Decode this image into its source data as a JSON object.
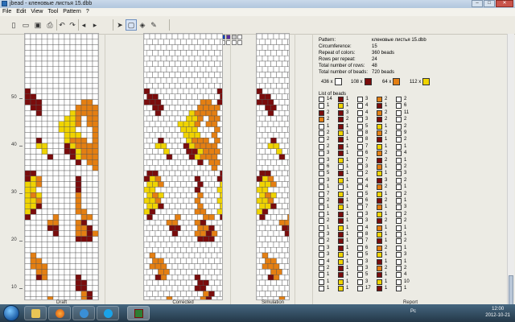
{
  "window": {
    "title": "jbead - кленовые листья 15.dbb",
    "min": "–",
    "max": "□",
    "close": "✕"
  },
  "menu": [
    "File",
    "Edit",
    "View",
    "Tool",
    "Pattern",
    "?"
  ],
  "toolbar_icons": [
    "new-icon",
    "open-icon",
    "save-icon",
    "print-icon",
    "undo-icon",
    "redo-icon",
    "arrow-left-icon",
    "arrow-right-icon",
    "pointer-icon",
    "rectangle-select-icon",
    "fill-icon",
    "pencil-icon"
  ],
  "palette_colors": [
    "#000000",
    "#6d0a0a",
    "#d4d400",
    "#e8e800",
    "#ee1c24",
    "#f08c00",
    "#3cb44b",
    "#00a0e0",
    "#0040c0",
    "#5a2da0",
    "#c8c8c8",
    "#ffffff",
    "#7a7a7a",
    "#a05a2c",
    "#c0d000",
    "#00c000",
    "#ff80c0",
    "#40e0d0",
    "#3060ff",
    "#a000a0",
    "#ffffff",
    "#ffffff",
    "#ffffff",
    "#ffffff"
  ],
  "bead_colors": {
    "white": "#ffffff",
    "dark": "#7a0c0c",
    "yellow": "#f0d400",
    "orange": "#e47f12"
  },
  "ruler": [
    "10",
    "20",
    "30",
    "40",
    "50"
  ],
  "panels": {
    "draft": "Draft",
    "corrected": "Corrected",
    "simulation": "Simulation",
    "report": "Report"
  },
  "pattern": "0000000000000,0000000000000,0000000000000,0000000000000,0000000000000,0000000000000,0000000000000,0000000000000,0000000000000,0000000000000,1000000000000,1100000000000,1110000000220,0110000002222,0010000032222,0000000332022,0000003332022,0000003330002,0000000333002,0010000322202,0033000132222,0003000113222,0000100013222,0000000001022,0000000000002,1100000000000,1320000001000,3320000001000,3300000001000,3230000002000,3320000002000,3310000002000,3100000002200,1000020000220,0000220002100,0000110002210,0000010002212,0000000001110,0000000000000,0000000000000,0200000000000,0220000000000,0222000000000,0022000000000,0012000001000,0000000001100,0000000001100,0000000000210,0000200000210,0002200002210,0002200002121,0001100001111,0000000000110,0000000000000,0000000000000,0000000000000,0200000000000,0220000000000,0222000000000,0022000000000,0012000000000,0000000000000,0000000000000,0000000000000,0000000000000,0000000000000",
  "info": {
    "pattern_label": "Pattern:",
    "pattern_value": "кленовые листья 15.dbb",
    "circ_label": "Circumference:",
    "circ_value": "15",
    "repeat_label": "Repeat of colors:",
    "repeat_value": "360 beads",
    "rows_label": "Rows per repeat:",
    "rows_value": "24",
    "total_rows_label": "Total number of rows:",
    "total_rows_value": "48",
    "total_beads_label": "Total number of beads:",
    "total_beads_value": "720 beads"
  },
  "counts": [
    {
      "count": "436 x",
      "color": "#ffffff"
    },
    {
      "count": "108 x",
      "color": "#7a0c0c"
    },
    {
      "count": "64 x",
      "color": "#e47f12"
    },
    {
      "count": "112 x",
      "color": "#f0d400"
    }
  ],
  "list_title": "List of beads",
  "bead_list": [
    [
      [
        "w",
        "14"
      ],
      [
        "w",
        "1"
      ],
      [
        "d",
        "2"
      ],
      [
        "o",
        "2"
      ],
      [
        "w",
        "1"
      ],
      [
        "w",
        "2"
      ],
      [
        "w",
        "2"
      ],
      [
        "w",
        "2"
      ],
      [
        "w",
        "3"
      ],
      [
        "w",
        "3"
      ],
      [
        "w",
        "6"
      ],
      [
        "w",
        "5"
      ],
      [
        "w",
        "3"
      ],
      [
        "w",
        "1"
      ],
      [
        "w",
        "7"
      ],
      [
        "w",
        "2"
      ],
      [
        "w",
        "1"
      ],
      [
        "w",
        "1"
      ],
      [
        "w",
        "2"
      ],
      [
        "w",
        "1"
      ],
      [
        "w",
        "3"
      ],
      [
        "w",
        "2"
      ],
      [
        "w",
        "3"
      ],
      [
        "w",
        "3"
      ],
      [
        "w",
        "4"
      ],
      [
        "w",
        "2"
      ],
      [
        "w",
        "1"
      ],
      [
        "w",
        "1"
      ],
      [
        "w",
        "1"
      ]
    ],
    [
      [
        "d",
        "1"
      ],
      [
        "y",
        "1"
      ],
      [
        "d",
        "3"
      ],
      [
        "d",
        "2"
      ],
      [
        "d",
        "1"
      ],
      [
        "y",
        "1"
      ],
      [
        "d",
        "1"
      ],
      [
        "d",
        "1"
      ],
      [
        "d",
        "1"
      ],
      [
        "y",
        "1"
      ],
      [
        "w",
        "1"
      ],
      [
        "d",
        "1"
      ],
      [
        "y",
        "1"
      ],
      [
        "w",
        "1"
      ],
      [
        "y",
        "1"
      ],
      [
        "d",
        "1"
      ],
      [
        "y",
        "1"
      ],
      [
        "d",
        "1"
      ],
      [
        "d",
        "1"
      ],
      [
        "y",
        "1"
      ],
      [
        "d",
        "1"
      ],
      [
        "d",
        "1"
      ],
      [
        "d",
        "1"
      ],
      [
        "y",
        "1"
      ],
      [
        "y",
        "1"
      ],
      [
        "d",
        "1"
      ],
      [
        "d",
        "1"
      ],
      [
        "y",
        "1"
      ],
      [
        "y",
        "1"
      ]
    ],
    [
      [
        "w",
        "3"
      ],
      [
        "w",
        "4"
      ],
      [
        "w",
        "4"
      ],
      [
        "w",
        "3"
      ],
      [
        "w",
        "5"
      ],
      [
        "w",
        "8"
      ],
      [
        "w",
        "8"
      ],
      [
        "w",
        "7"
      ],
      [
        "w",
        "6"
      ],
      [
        "w",
        "7"
      ],
      [
        "w",
        "3"
      ],
      [
        "w",
        "2"
      ],
      [
        "w",
        "4"
      ],
      [
        "w",
        "4"
      ],
      [
        "w",
        "5"
      ],
      [
        "w",
        "6"
      ],
      [
        "w",
        "7"
      ],
      [
        "w",
        "3"
      ],
      [
        "w",
        "3"
      ],
      [
        "w",
        "4"
      ],
      [
        "w",
        "8"
      ],
      [
        "w",
        "7"
      ],
      [
        "w",
        "6"
      ],
      [
        "w",
        "5"
      ],
      [
        "w",
        "3"
      ],
      [
        "w",
        "3"
      ],
      [
        "w",
        "5"
      ],
      [
        "w",
        "3"
      ],
      [
        "w",
        "17"
      ]
    ],
    [
      [
        "o",
        "2"
      ],
      [
        "d",
        "1"
      ],
      [
        "o",
        "2"
      ],
      [
        "d",
        "2"
      ],
      [
        "y",
        "1"
      ],
      [
        "o",
        "2"
      ],
      [
        "d",
        "1"
      ],
      [
        "y",
        "1"
      ],
      [
        "o",
        "2"
      ],
      [
        "d",
        "2"
      ],
      [
        "o",
        "1"
      ],
      [
        "y",
        "1"
      ],
      [
        "d",
        "3"
      ],
      [
        "o",
        "2"
      ],
      [
        "y",
        "1"
      ],
      [
        "d",
        "2"
      ],
      [
        "o",
        "1"
      ],
      [
        "y",
        "1"
      ],
      [
        "d",
        "2"
      ],
      [
        "o",
        "1"
      ],
      [
        "y",
        "1"
      ],
      [
        "d",
        "1"
      ],
      [
        "o",
        "2"
      ],
      [
        "y",
        "1"
      ],
      [
        "d",
        "1"
      ],
      [
        "o",
        "2"
      ],
      [
        "d",
        "1"
      ],
      [
        "y",
        "1"
      ],
      [
        "d",
        "1"
      ]
    ],
    [
      [
        "w",
        "2"
      ],
      [
        "w",
        "6"
      ],
      [
        "w",
        "11"
      ],
      [
        "w",
        "2"
      ],
      [
        "w",
        "2"
      ],
      [
        "w",
        "9"
      ],
      [
        "w",
        "2"
      ],
      [
        "w",
        "1"
      ],
      [
        "w",
        "4"
      ],
      [
        "w",
        "1"
      ],
      [
        "w",
        "2"
      ],
      [
        "w",
        "3"
      ],
      [
        "w",
        "2"
      ],
      [
        "w",
        "1"
      ],
      [
        "w",
        "2"
      ],
      [
        "w",
        "1"
      ],
      [
        "w",
        "3"
      ],
      [
        "w",
        "2"
      ],
      [
        "w",
        "2"
      ],
      [
        "w",
        "1"
      ],
      [
        "w",
        "1"
      ],
      [
        "w",
        "2"
      ],
      [
        "w",
        "1"
      ],
      [
        "w",
        "3"
      ],
      [
        "w",
        "1"
      ],
      [
        "w",
        "2"
      ],
      [
        "w",
        "4"
      ],
      [
        "w",
        "10"
      ],
      [
        "w",
        "1"
      ]
    ]
  ],
  "taskbar": {
    "lang": "Рс",
    "time": "12:00",
    "date": "2012-10-21"
  }
}
